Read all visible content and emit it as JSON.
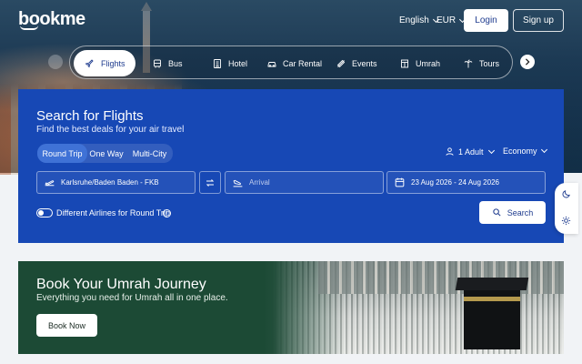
{
  "header": {
    "logo": "bookme",
    "language": "English",
    "currency": "EUR",
    "login_label": "Login",
    "signup_label": "Sign up"
  },
  "categories": [
    {
      "label": "Flights",
      "icon": "plane-icon",
      "active": true
    },
    {
      "label": "Bus",
      "icon": "bus-icon",
      "active": false
    },
    {
      "label": "Hotel",
      "icon": "hotel-icon",
      "active": false
    },
    {
      "label": "Car Rental",
      "icon": "car-icon",
      "active": false
    },
    {
      "label": "Events",
      "icon": "ticket-icon",
      "active": false
    },
    {
      "label": "Umrah",
      "icon": "kaaba-icon",
      "active": false
    },
    {
      "label": "Tours",
      "icon": "palm-icon",
      "active": false
    }
  ],
  "search": {
    "title": "Search for Flights",
    "subtitle": "Find the best deals for your air travel",
    "trip_types": [
      "Round Trip",
      "One Way",
      "Multi-City"
    ],
    "selected_trip": "Round Trip",
    "passengers": "1 Adult",
    "cabin_class": "Economy",
    "departure_value": "Karlsruhe/Baden Baden -  FKB",
    "arrival_placeholder": "Arrival",
    "dates_value": "23 Aug 2026  - 24 Aug 2026",
    "different_airlines_label": "Different Airlines for Round Trip",
    "search_button": "Search"
  },
  "banner": {
    "title": "Book Your Umrah Journey",
    "subtitle": "Everything you need for Umrah all in one place.",
    "button": "Book Now"
  },
  "colors": {
    "panel": "#1748b5",
    "brand_text": "#1f3c8f",
    "banner_green": "#1c4a35"
  }
}
